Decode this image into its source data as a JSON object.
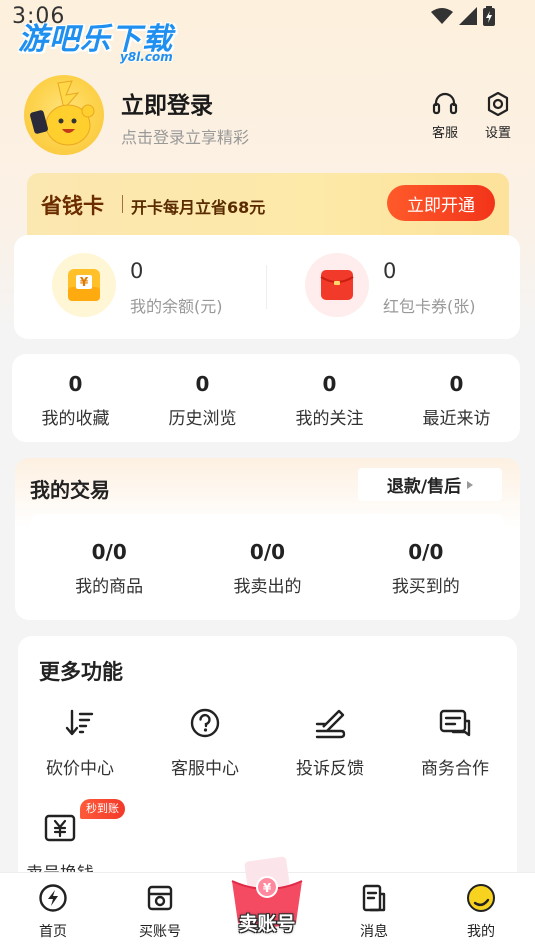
{
  "status_bar": {
    "time": "3:06"
  },
  "watermark": {
    "text": "游吧乐下载",
    "sub": "y8l.com"
  },
  "profile": {
    "login_title": "立即登录",
    "login_subtitle": "点击登录立享精彩",
    "actions": [
      {
        "label": "客服",
        "icon": "headset-icon"
      },
      {
        "label": "设置",
        "icon": "gear-icon"
      }
    ]
  },
  "savings_card": {
    "title": "省钱卡",
    "description": "开卡每月立省68元",
    "button_label": "立即开通"
  },
  "balance": {
    "items": [
      {
        "value": "0",
        "label": "我的余额(元)",
        "icon": "yuan-wallet-icon"
      },
      {
        "value": "0",
        "label": "红包卡券(张)",
        "icon": "red-envelope-icon"
      }
    ]
  },
  "stats": [
    {
      "value": "0",
      "label": "我的收藏"
    },
    {
      "value": "0",
      "label": "历史浏览"
    },
    {
      "value": "0",
      "label": "我的关注"
    },
    {
      "value": "0",
      "label": "最近来访"
    }
  ],
  "trade": {
    "title": "我的交易",
    "refund_label": "退款/售后",
    "items": [
      {
        "value": "0/0",
        "label": "我的商品"
      },
      {
        "value": "0/0",
        "label": "我卖出的"
      },
      {
        "value": "0/0",
        "label": "我买到的"
      }
    ]
  },
  "more_features": {
    "title": "更多功能",
    "items": [
      {
        "label": "砍价中心",
        "icon": "sort-down-icon"
      },
      {
        "label": "客服中心",
        "icon": "help-circle-icon"
      },
      {
        "label": "投诉反馈",
        "icon": "pen-feedback-icon"
      },
      {
        "label": "商务合作",
        "icon": "chat-box-icon"
      },
      {
        "label": "卖号换钱",
        "icon": "yuan-ticket-icon",
        "badge": "秒到账"
      }
    ]
  },
  "bottom_nav": {
    "items": [
      {
        "label": "首页",
        "icon": "lightning-circle-icon"
      },
      {
        "label": "买账号",
        "icon": "shop-bag-icon"
      },
      {
        "label": "卖账号",
        "icon": "gift-box-icon"
      },
      {
        "label": "消息",
        "icon": "message-doc-icon"
      },
      {
        "label": "我的",
        "icon": "profile-face-icon"
      }
    ]
  },
  "colors": {
    "accent_red": "#f2341a",
    "savings_text": "#6b2c00",
    "watermark_blue": "#1f8ff0"
  }
}
